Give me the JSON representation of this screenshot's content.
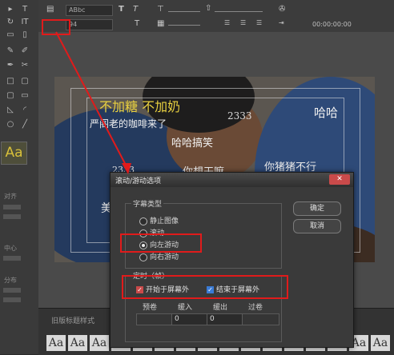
{
  "toolbar": {
    "font_combo": "ABbc",
    "size_combo": "94",
    "bold_icon": "T",
    "italic_icon": "T",
    "timecode": "00:00:00:00"
  },
  "left_panel": {
    "text_style_sample": "Aa",
    "section_labels": [
      "对齐",
      "中心",
      "分布"
    ]
  },
  "video_overlay": {
    "line1": "不加糖 不加奶",
    "line2": "严阁老的咖啡来了",
    "line3": "哈哈搞笑",
    "hash1": "2333",
    "haha": "哈哈",
    "hash2": "2333",
    "line_partial_a": "你想干嘛",
    "line_partial_b": "你猪猪不行",
    "line_partial_c": "美"
  },
  "bottom_panel": {
    "label": "旧版标题样式",
    "style_samples": [
      "Aa",
      "Aa",
      "Aa",
      "Aa",
      "Aa",
      "Aa",
      "Aa",
      "Aa",
      "Aa",
      "Aa",
      "Aa",
      "Aa",
      "Aa",
      "Aa",
      "Aa",
      "Aa"
    ]
  },
  "dialog": {
    "title": "滚动/游动选项",
    "close_label": "✕",
    "ok_label": "确定",
    "cancel_label": "取消",
    "group_caption_type": "字幕类型",
    "options": [
      {
        "label": "静止图像",
        "selected": false
      },
      {
        "label": "滚动",
        "selected": false
      },
      {
        "label": "向左游动",
        "selected": true
      },
      {
        "label": "向右游动",
        "selected": false
      }
    ],
    "group_timing": "定时（帧）",
    "start_offscreen_label": "开始于屏幕外",
    "end_offscreen_label": "结束于屏幕外",
    "start_offscreen_checked": true,
    "end_offscreen_checked": true,
    "columns": [
      "预卷",
      "缓入",
      "缓出",
      "过卷"
    ],
    "values": [
      "",
      "0",
      "0",
      ""
    ]
  },
  "colors": {
    "annotation_red": "#e01b1b",
    "caption_yellow": "#e8d040",
    "checkbox_red": "#c94a4a",
    "checkbox_blue": "#3a7bd5"
  }
}
